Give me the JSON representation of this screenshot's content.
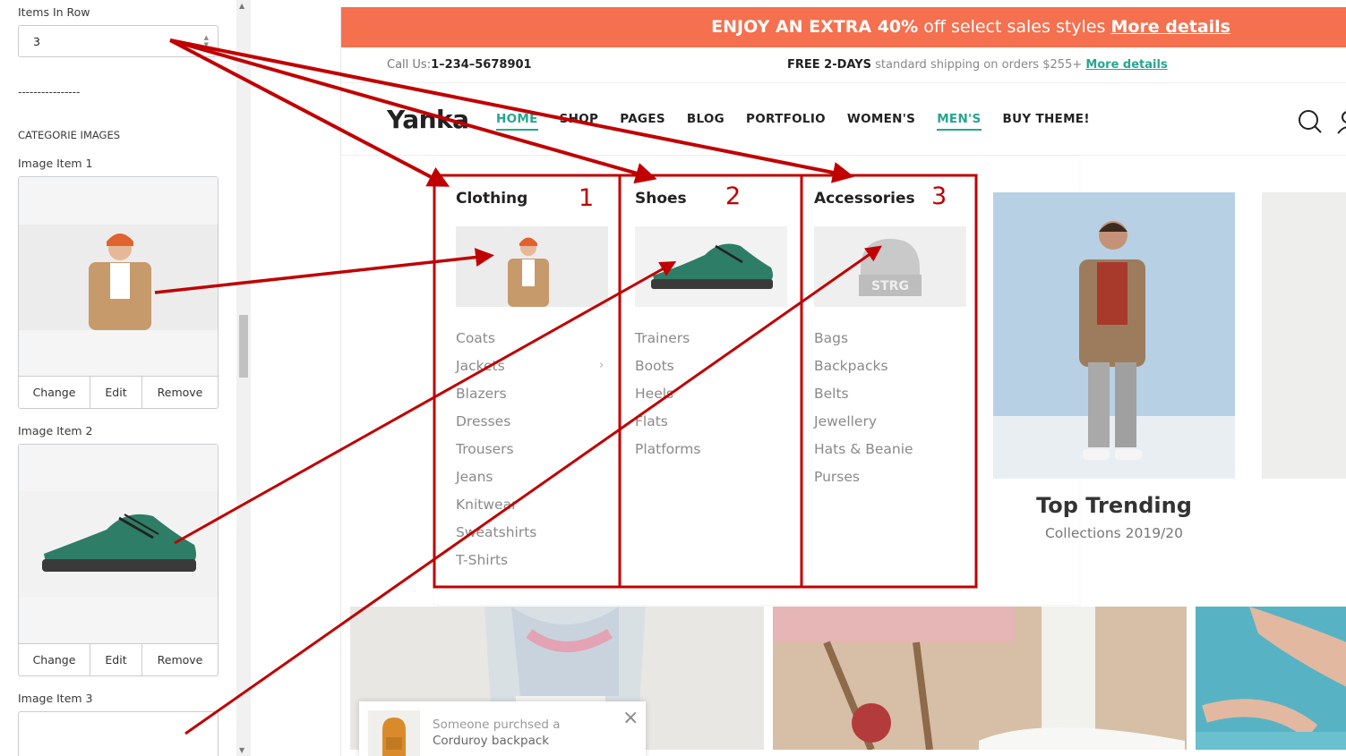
{
  "settings_panel": {
    "items_in_row_label": "Items In Row",
    "items_in_row_value": "3",
    "separator": "----------------",
    "section_title": "CATEGORIE IMAGES",
    "image_items": [
      {
        "label": "Image Item 1",
        "buttons": [
          "Change",
          "Edit",
          "Remove"
        ]
      },
      {
        "label": "Image Item 2",
        "buttons": [
          "Change",
          "Edit",
          "Remove"
        ]
      },
      {
        "label": "Image Item 3"
      }
    ]
  },
  "store": {
    "promo": {
      "bold_text": "ENJOY AN EXTRA 40%",
      "text": " off select sales styles ",
      "link": "More details"
    },
    "topbar": {
      "call_label": "Call Us:",
      "phone": "1–234–5678901",
      "shipping_bold": "FREE 2-DAYS",
      "shipping_text": " standard shipping on orders $255+ ",
      "shipping_link": "More details"
    },
    "logo": "Yanka",
    "nav": [
      "HOME",
      "SHOP",
      "PAGES",
      "BLOG",
      "PORTFOLIO",
      "WOMEN'S",
      "MEN'S",
      "BUY THEME!"
    ],
    "mega_menu": [
      {
        "title": "Clothing",
        "items": [
          "Coats",
          "Jackets",
          "Blazers",
          "Dresses",
          "Trousers",
          "Jeans",
          "Knitwear",
          "Sweatshirts",
          "T-Shirts"
        ]
      },
      {
        "title": "Shoes",
        "items": [
          "Trainers",
          "Boots",
          "Heels",
          "Flats",
          "Platforms"
        ]
      },
      {
        "title": "Accessories",
        "items": [
          "Bags",
          "Backpacks",
          "Belts",
          "Jewellery",
          "Hats & Beanie",
          "Purses"
        ]
      }
    ],
    "trending": {
      "title": "Top Trending",
      "subtitle": "Collections 2019/20"
    },
    "toast": {
      "line1": "Someone purchsed a",
      "line2": "Corduroy backpack"
    },
    "beanie_text": "STRG"
  },
  "annotations": {
    "numbers": [
      "1",
      "2",
      "3"
    ],
    "color": "#c00000"
  },
  "colors": {
    "promo_bg": "#f5704f",
    "accent": "#27a58f",
    "annotation": "#c00000"
  }
}
